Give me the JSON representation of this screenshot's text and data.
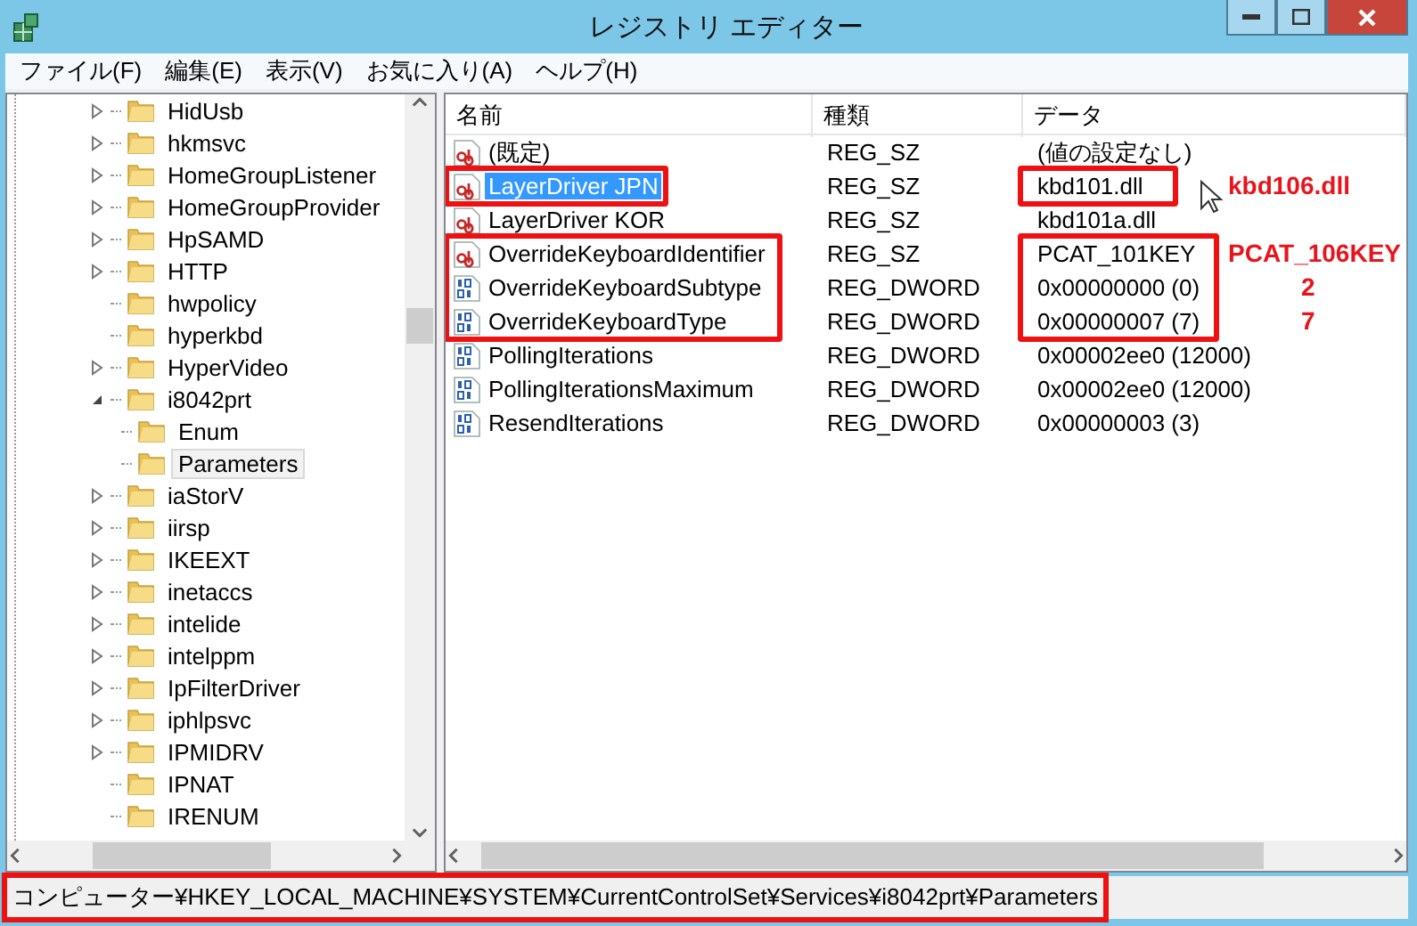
{
  "window": {
    "title": "レジストリ エディター"
  },
  "menu": [
    "ファイル(F)",
    "編集(E)",
    "表示(V)",
    "お気に入り(A)",
    "ヘルプ(H)"
  ],
  "tree": [
    {
      "label": "HidUsb",
      "kind": "branch",
      "expanded": false,
      "selected": false
    },
    {
      "label": "hkmsvc",
      "kind": "branch",
      "expanded": false,
      "selected": false
    },
    {
      "label": "HomeGroupListener",
      "kind": "branch",
      "expanded": false,
      "selected": false
    },
    {
      "label": "HomeGroupProvider",
      "kind": "branch",
      "expanded": false,
      "selected": false
    },
    {
      "label": "HpSAMD",
      "kind": "branch",
      "expanded": false,
      "selected": false
    },
    {
      "label": "HTTP",
      "kind": "branch",
      "expanded": false,
      "selected": false
    },
    {
      "label": "hwpolicy",
      "kind": "leaf",
      "selected": false
    },
    {
      "label": "hyperkbd",
      "kind": "leaf",
      "selected": false
    },
    {
      "label": "HyperVideo",
      "kind": "branch",
      "expanded": false,
      "selected": false
    },
    {
      "label": "i8042prt",
      "kind": "branch",
      "expanded": true,
      "selected": false,
      "children": [
        {
          "label": "Enum",
          "selected": false
        },
        {
          "label": "Parameters",
          "selected": true
        }
      ]
    },
    {
      "label": "iaStorV",
      "kind": "branch",
      "expanded": false,
      "selected": false
    },
    {
      "label": "iirsp",
      "kind": "branch",
      "expanded": false,
      "selected": false
    },
    {
      "label": "IKEEXT",
      "kind": "branch",
      "expanded": false,
      "selected": false
    },
    {
      "label": "inetaccs",
      "kind": "branch",
      "expanded": false,
      "selected": false
    },
    {
      "label": "intelide",
      "kind": "branch",
      "expanded": false,
      "selected": false
    },
    {
      "label": "intelppm",
      "kind": "branch",
      "expanded": false,
      "selected": false
    },
    {
      "label": "IpFilterDriver",
      "kind": "branch",
      "expanded": false,
      "selected": false
    },
    {
      "label": "iphlpsvc",
      "kind": "branch",
      "expanded": false,
      "selected": false
    },
    {
      "label": "IPMIDRV",
      "kind": "branch",
      "expanded": false,
      "selected": false
    },
    {
      "label": "IPNAT",
      "kind": "leaf",
      "selected": false
    },
    {
      "label": "IRENUM",
      "kind": "leaf",
      "selected": false
    }
  ],
  "table": {
    "columns": [
      "名前",
      "種類",
      "データ"
    ],
    "rows": [
      {
        "kind": "string",
        "name": "(既定)",
        "type": "REG_SZ",
        "data": "(値の設定なし)",
        "selected": false
      },
      {
        "kind": "string",
        "name": "LayerDriver JPN",
        "type": "REG_SZ",
        "data": "kbd101.dll",
        "selected": true,
        "note": "kbd106.dll"
      },
      {
        "kind": "string",
        "name": "LayerDriver KOR",
        "type": "REG_SZ",
        "data": "kbd101a.dll",
        "selected": false
      },
      {
        "kind": "string",
        "name": "OverrideKeyboardIdentifier",
        "type": "REG_SZ",
        "data": "PCAT_101KEY",
        "selected": false,
        "note": "PCAT_106KEY"
      },
      {
        "kind": "binary",
        "name": "OverrideKeyboardSubtype",
        "type": "REG_DWORD",
        "data": "0x00000000 (0)",
        "selected": false,
        "note": "2"
      },
      {
        "kind": "binary",
        "name": "OverrideKeyboardType",
        "type": "REG_DWORD",
        "data": "0x00000007 (7)",
        "selected": false,
        "note": "7"
      },
      {
        "kind": "binary",
        "name": "PollingIterations",
        "type": "REG_DWORD",
        "data": "0x00002ee0 (12000)",
        "selected": false
      },
      {
        "kind": "binary",
        "name": "PollingIterationsMaximum",
        "type": "REG_DWORD",
        "data": "0x00002ee0 (12000)",
        "selected": false
      },
      {
        "kind": "binary",
        "name": "ResendIterations",
        "type": "REG_DWORD",
        "data": "0x00000003 (3)",
        "selected": false
      }
    ]
  },
  "status_bar": "コンピューター¥HKEY_LOCAL_MACHINE¥SYSTEM¥CurrentControlSet¥Services¥i8042prt¥Parameters"
}
